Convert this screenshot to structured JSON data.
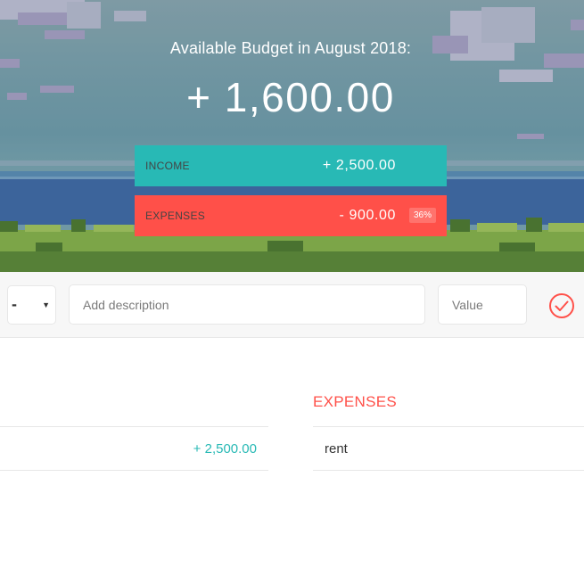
{
  "header": {
    "title": "Available Budget in August 2018:",
    "budget": "+ 1,600.00",
    "income": {
      "label": "INCOME",
      "value": "+ 2,500.00"
    },
    "expenses": {
      "label": "EXPENSES",
      "value": "- 900.00",
      "percentage": "36%"
    }
  },
  "add_form": {
    "type_selected": "-",
    "description_placeholder": "Add description",
    "value_placeholder": "Value",
    "submit_icon": "check-circle-icon"
  },
  "lists": {
    "income_items": [
      {
        "amount": "+ 2,500.00"
      }
    ],
    "expenses_title": "EXPENSES",
    "expense_items": [
      {
        "description": "rent"
      }
    ]
  },
  "colors": {
    "income": "#28b9b5",
    "expense": "#ff5049"
  }
}
